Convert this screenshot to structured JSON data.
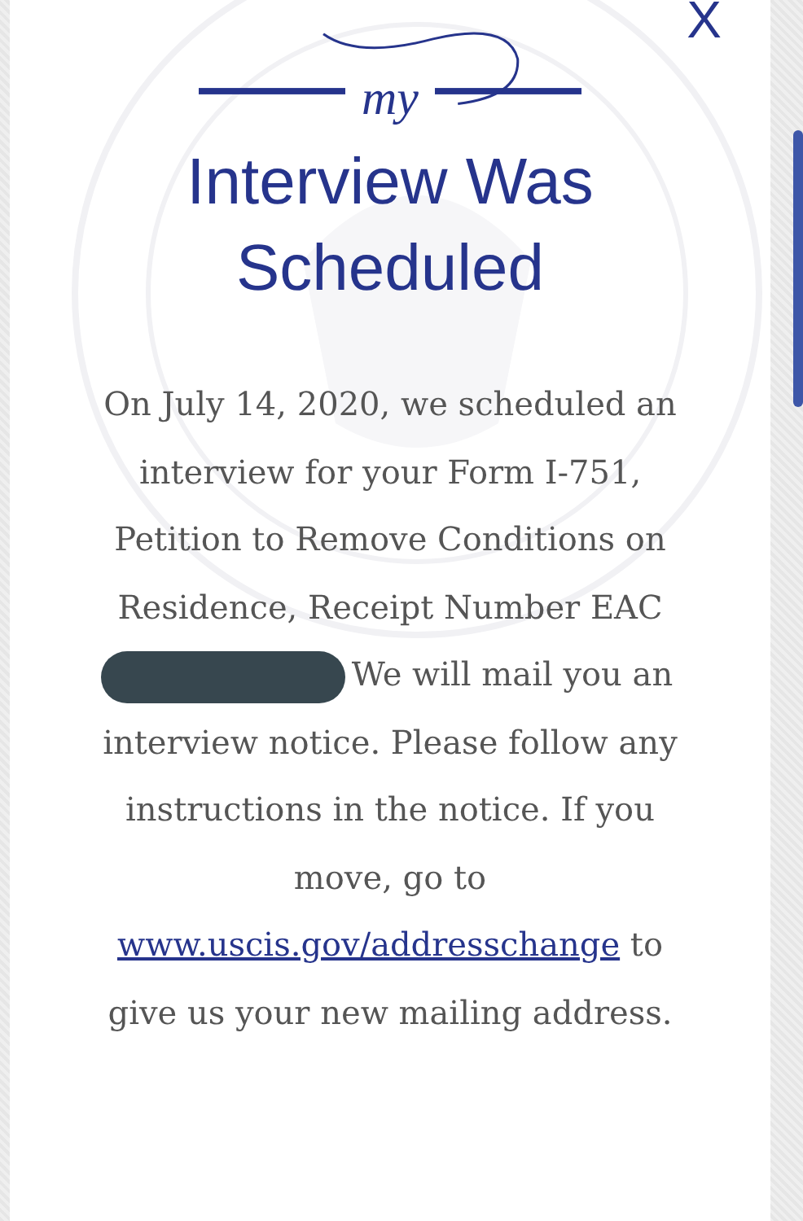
{
  "close": "X",
  "logo": {
    "text": "my"
  },
  "title": "Interview Was Scheduled",
  "message": {
    "before": "On July 14, 2020, we scheduled an interview for your Form I-751, Petition to Remove Conditions on Residence, Receipt Number EAC",
    "after": "We will mail you an interview notice. Please follow any instructions in the notice. If you move, go to",
    "link": "www.uscis.gov/addresschange",
    "end": "to give us your new mailing address."
  }
}
